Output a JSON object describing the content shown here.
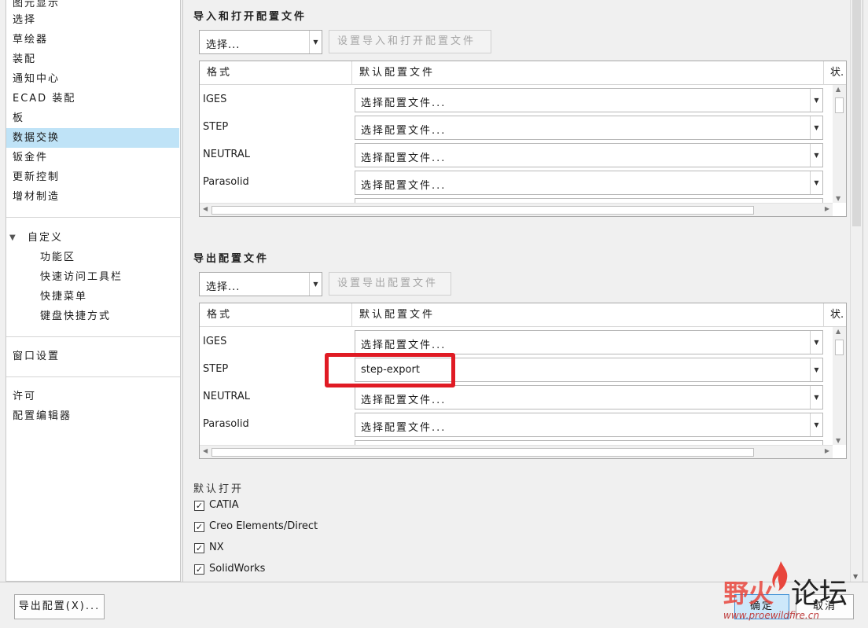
{
  "sidebar": {
    "items": [
      {
        "label": "图元显示"
      },
      {
        "label": "选择"
      },
      {
        "label": "草绘器"
      },
      {
        "label": "装配"
      },
      {
        "label": "通知中心"
      },
      {
        "label": "ECAD 装配"
      },
      {
        "label": "板"
      },
      {
        "label": "数据交换",
        "selected": true
      },
      {
        "label": "钣金件"
      },
      {
        "label": "更新控制"
      },
      {
        "label": "增材制造"
      }
    ],
    "custom_group": {
      "label": "自定义",
      "children": [
        "功能区",
        "快速访问工具栏",
        "快捷菜单",
        "键盘快捷方式"
      ]
    },
    "window_settings": "窗口设置",
    "license": "许可",
    "config_editor": "配置编辑器"
  },
  "import_section": {
    "title": "导入和打开配置文件",
    "select_value": "选择...",
    "set_button": "设置导入和打开配置文件",
    "columns": [
      "格式",
      "默认配置文件",
      "状."
    ],
    "rows": [
      {
        "format": "IGES",
        "profile": "选择配置文件..."
      },
      {
        "format": "STEP",
        "profile": "选择配置文件..."
      },
      {
        "format": "NEUTRAL",
        "profile": "选择配置文件..."
      },
      {
        "format": "Parasolid",
        "profile": "选择配置文件..."
      }
    ]
  },
  "export_section": {
    "title": "导出配置文件",
    "select_value": "选择...",
    "set_button": "设置导出配置文件",
    "columns": [
      "格式",
      "默认配置文件",
      "状."
    ],
    "rows": [
      {
        "format": "IGES",
        "profile": "选择配置文件..."
      },
      {
        "format": "STEP",
        "profile": "step-export"
      },
      {
        "format": "NEUTRAL",
        "profile": "选择配置文件..."
      },
      {
        "format": "Parasolid",
        "profile": "选择配置文件..."
      }
    ]
  },
  "default_open": {
    "label": "默认打开",
    "items": [
      {
        "label": "CATIA",
        "checked": true
      },
      {
        "label": "Creo Elements/Direct",
        "checked": true
      },
      {
        "label": "NX",
        "checked": true
      },
      {
        "label": "SolidWorks",
        "checked": true
      }
    ]
  },
  "footer": {
    "export_config": "导出配置(X)...",
    "ok": "确定",
    "cancel": "取消"
  },
  "watermark": {
    "brand_red": "野火",
    "brand_black": "论坛",
    "url": "www.proewildfire.cn"
  },
  "colors": {
    "selected_bg": "#bfe3f7",
    "highlight_border": "#e01b24"
  }
}
